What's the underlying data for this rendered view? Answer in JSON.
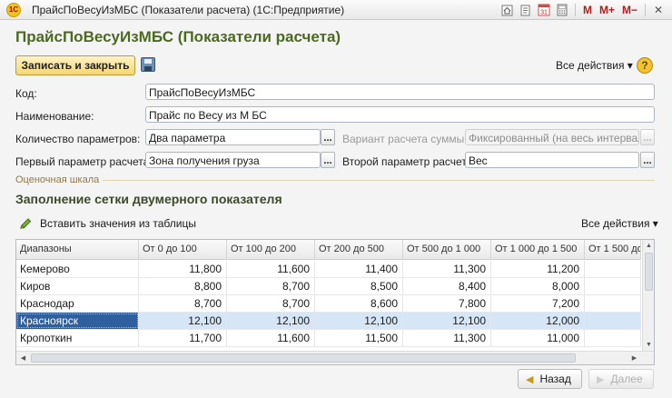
{
  "window": {
    "app_icon": "1С",
    "title": "ПрайсПоВесуИзМБС (Показатели расчета)  (1С:Предприятие)",
    "icons": [
      "home-icon",
      "history-icon",
      "calendar-icon",
      "calculator-icon",
      "memory-plus-icon",
      "memory-minus-icon",
      "close-icon"
    ],
    "calendar_day": "31",
    "m": "M",
    "m_plus": "M+",
    "m_minus": "M−",
    "close": "✕"
  },
  "form": {
    "title": "ПрайсПоВесуИзМБС (Показатели расчета)",
    "save_close_label": "Записать и закрыть",
    "all_actions_label": "Все действия ▾",
    "help_glyph": "?"
  },
  "fields": {
    "code_label": "Код:",
    "code_value": "ПрайсПоВесуИзМБС",
    "name_label": "Наименование:",
    "name_value": "Прайс по Весу из М БС",
    "param_count_label": "Количество параметров:",
    "param_count_value": "Два параметра",
    "sum_variant_label": "Вариант расчета суммы:",
    "sum_variant_value": "Фиксированный (на весь интервал)",
    "first_param_label": "Первый параметр расчета:",
    "first_param_value": "Зона получения груза",
    "second_param_label": "Второй параметр расчета:",
    "second_param_value": "Вес",
    "choose_glyph": "..."
  },
  "scale": {
    "group_label": "Оценочная шкала",
    "section_title": "Заполнение сетки двумерного показателя",
    "paste_label": "Вставить значения из таблицы",
    "all_actions_label": "Все действия ▾"
  },
  "grid": {
    "columns": [
      "Диапазоны",
      "От 0 до 100",
      "От 100 до 200",
      "От 200 до 500",
      "От 500 до 1 000",
      "От 1 000 до 1 500",
      "От 1 500 до"
    ],
    "rows": [
      {
        "name": "Кемерово",
        "values": [
          "11,800",
          "11,600",
          "11,400",
          "11,300",
          "11,200",
          ""
        ]
      },
      {
        "name": "Киров",
        "values": [
          "8,800",
          "8,700",
          "8,500",
          "8,400",
          "8,000",
          ""
        ]
      },
      {
        "name": "Краснодар",
        "values": [
          "8,700",
          "8,700",
          "8,600",
          "7,800",
          "7,200",
          ""
        ]
      },
      {
        "name": "Красноярск",
        "values": [
          "12,100",
          "12,100",
          "12,100",
          "12,100",
          "12,000",
          ""
        ],
        "selected": true
      },
      {
        "name": "Кропоткин",
        "values": [
          "11,700",
          "11,600",
          "11,500",
          "11,300",
          "11,000",
          ""
        ]
      }
    ]
  },
  "navigation": {
    "back_label": "Назад",
    "next_label": "Далее"
  },
  "colors": {
    "title_green": "#4b6a1f",
    "save_button_yellow": "#f6d672",
    "selection_blue": "#2f5f9c",
    "row_highlight": "#d7e6f7"
  }
}
